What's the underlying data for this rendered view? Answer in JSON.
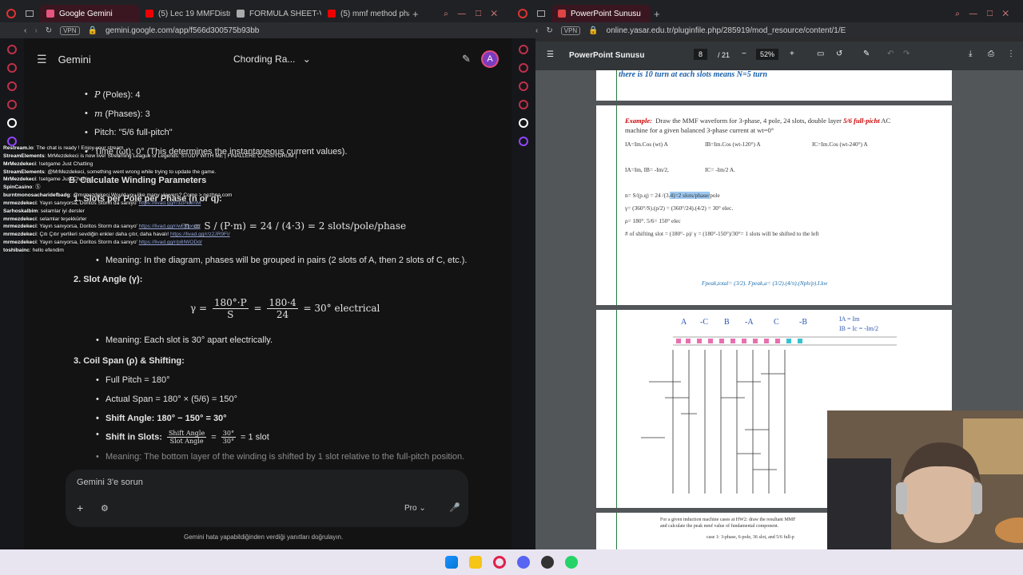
{
  "left_browser": {
    "tabs": [
      {
        "label": "Google Gemini",
        "active": true
      },
      {
        "label": "(5) Lec 19 MMFDistrib",
        "active": false
      },
      {
        "label": "FORMULA SHEET-V6",
        "active": false
      },
      {
        "label": "(5) mmf method phas",
        "active": false
      }
    ],
    "url": "gemini.google.com/app/f566d300575b93bb",
    "vpn": "VPN"
  },
  "gemini": {
    "brand": "Gemini",
    "chat_title": "Chording Ra...",
    "avatar_letter": "A",
    "content": {
      "poles_label": "(Poles): 4",
      "phases_label": "(Phases): 3",
      "pitch_label": "Pitch: \"5/6 full-pitch\"",
      "time_label": "Time (ωt): 0° (This determines the instantaneous current values).",
      "section_b": "B. Calculate Winding Parameters",
      "item1_title": "1.  Slots per Pole per Phase (n or q):",
      "item1_formula": "n = S / (P·m) = 24 / (4·3) = 2 slots/pole/phase",
      "item1_meaning": "Meaning: In the diagram, phases will be grouped in pairs (2 slots of A, then 2 slots of C, etc.).",
      "item2_title": "2.  Slot Angle (γ):",
      "item2_formula_result": "= 30° electrical",
      "item2_meaning": "Meaning: Each slot is 30° apart electrically.",
      "item3_title": "3.  Coil Span (ρ) & Shifting:",
      "full_pitch": "Full Pitch = 180°",
      "actual_span": "Actual Span = 180° × (5/6) = 150°",
      "shift_angle": "Shift Angle: 180° − 150° = 30°",
      "shift_slots_label": "Shift in Slots:",
      "shift_slots_result": "= 1 slot",
      "last_meaning": "Meaning: The bottom layer of the winding is shifted by 1 slot relative to the full-pitch position."
    },
    "input_placeholder": "Gemini 3'e sorun",
    "mode": "Pro",
    "disclaimer": "Gemini hata yapabildiğinden verdiği yanıtları doğrulayın."
  },
  "chat_overlay": [
    {
      "name": "Restream.io",
      "text": "The chat is ready ! Enjoy your stream"
    },
    {
      "name": "StreamElements",
      "text": "MrMezdekeci is now live! Streaming League of Legends: STUDY WITH ME | FINALLERE CALISIYORUM |"
    },
    {
      "name": "MrMezdekeci",
      "text": "!setgame Just Chatting"
    },
    {
      "name": "StreamElements",
      "text": "@MrMezdekeci, something went wrong while trying to update the game."
    },
    {
      "name": "MrMezdekeci",
      "text": "!setgame Just Chatting"
    },
    {
      "name": "SpinCasino",
      "text": "Ⓢ"
    },
    {
      "name": "burntmonosacharidefbadg",
      "text": "@mrmezdekeci Would you like many viewers? Come > nezhna.com"
    },
    {
      "name": "mrmezdekeci",
      "text": "Yayın sanıyorsa, Doritos Storm da sanıyo'",
      "link": "https://livad.gg/r/3zPkkrnM"
    },
    {
      "name": "Sarhoskalbim",
      "text": "selamlar iyi dersler"
    },
    {
      "name": "mrmezdekeci",
      "text": "selamlar teşekkürler"
    },
    {
      "name": "mrmezdekeci",
      "text": "Yayın sanıyorsa, Doritos Storm da sanıyo'",
      "link": "https://livad.gg/r/wEkxxvY/"
    },
    {
      "name": "mrmezdekeci",
      "text": "Çıtı Çıtır yerlileri sevdiğin enkler daha çıtır, daha havalı!",
      "link": "https://livad.gg/r/z2JR9FI/"
    },
    {
      "name": "mrmezdekeci",
      "text": "Yayın sanıyorsa, Doritos Storm da sanıyo'",
      "link": "https://livad.gg/r/p8IWODd/"
    },
    {
      "name": "toshibainc",
      "text": "hello efendim"
    }
  ],
  "right_browser": {
    "tab_label": "PowerPoint Sunusu",
    "url": "online.yasar.edu.tr/pluginfile.php/285919/mod_resource/content/1/EEE%2",
    "vpn": "VPN",
    "pdf_title": "PowerPoint Sunusu",
    "page_current": "8",
    "page_total": "/ 21",
    "zoom": "52%"
  },
  "slides": {
    "top_line": "there is 10 turn at each slots means N=5 turn",
    "example_head": "Example:",
    "example_text": "Draw the MMF waveform for 3-phase, 4 pole, 24 slots, double layer",
    "example_red": "5/6 full-picht",
    "example_text2": "AC",
    "example_line2": "machine for a given balanced 3-phase current at wt=0°",
    "ia": "IA=Im.Cos (wt) A",
    "ib": "IB=Im.Cos (wt-120°) A",
    "ic": "IC=Im.Cos (wt-240°) A",
    "ia2": "IA=Im,    IB= -Im/2,",
    "ic2": "IC= -Im/2 A.",
    "n_pre": "n=  S/(p.q) = 24 /(3.",
    "n_hl": "4)=2 slots/phase/",
    "n_post": "pole",
    "gamma": "γ= (360°/S).(p/2) = (360°/24).(4/2) = 30°  elec.",
    "rho": "ρ= 180°. 5/6= 150° elec",
    "shift": "# of shifting slot = (180°- ρ)/ γ = (180°-150°)/30°= 1 slots will be shifted to the left",
    "fpeak": "Fpeak,total= (3/2). Fpeak,a= (3/2).(4/π).(Nph/p).I.kw",
    "bottom_text1": "For a given induction machine cases at HW2: draw the resultant MMF",
    "bottom_text2": "and calculate the peak mmf value of fundamental component.",
    "case1": "case 1: 3-phase, 6-pole, 36 slot, and 5/6 full-p",
    "hw_labels": [
      "A",
      "-C",
      "B",
      "-A",
      "C",
      "-B"
    ],
    "hw_ia": "IA = Im",
    "hw_ib": "IB = Ic = -Im/2"
  },
  "taskbar_apps": [
    "windows-start",
    "file-explorer",
    "opera",
    "discord",
    "obs",
    "whatsapp"
  ]
}
